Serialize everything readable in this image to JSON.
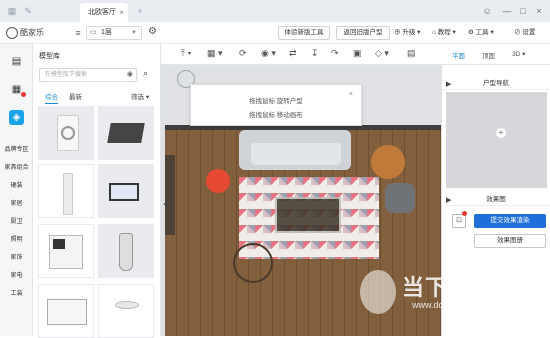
{
  "titlebar": {
    "tab_label": "北欧客厅",
    "tab_close": "×",
    "win_min": "—",
    "win_max": "□",
    "win_close": "×"
  },
  "toolbar": {
    "logo_text": "酷家乐",
    "floor_value": "1层",
    "try_new_tool": "体验新版工具",
    "back_old": "返回旧版户型",
    "upgrade": "升级",
    "tutorial": "教程",
    "tools": "工具",
    "settings": "设置"
  },
  "rail": {
    "items": [
      "品牌专区",
      "家具组合",
      "硬装",
      "家居",
      "厨卫",
      "照明",
      "家饰",
      "家电",
      "工装"
    ]
  },
  "library": {
    "title": "模型库",
    "search_placeholder": "在模型库下搜索",
    "tabs": [
      "综合",
      "最新"
    ],
    "filter": "筛选"
  },
  "canvas": {
    "tip_line1": "拖拽鼠标  旋转户型",
    "tip_line2": "拖拽鼠标  移动画布",
    "tip_close": "×"
  },
  "right": {
    "tabs": [
      "平面",
      "顶面",
      "3D"
    ],
    "nav_title": "户型导航",
    "effects_title": "效果图",
    "render_button": "提交效果渲染",
    "gallery_button": "效果图册"
  },
  "watermark": {
    "main": "当下软件园",
    "sub": "www.downxia.com"
  },
  "colors": {
    "accent": "#1aa3e8",
    "primary_button": "#1e6fd9",
    "badge": "#e53935"
  }
}
